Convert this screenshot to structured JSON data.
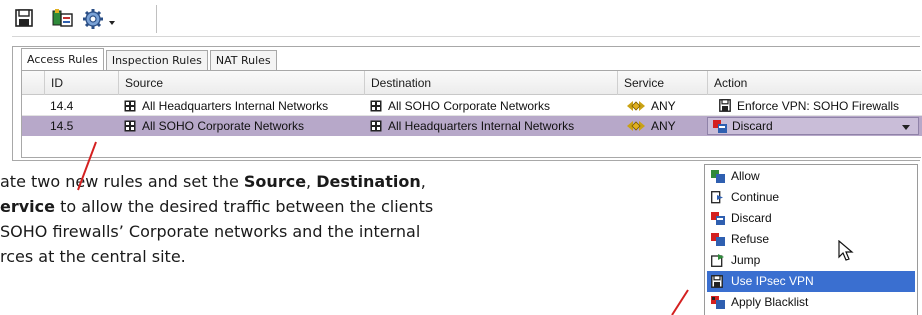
{
  "toolbar": {
    "icons": [
      "save-icon",
      "copy-policy-icon",
      "settings-gear-icon",
      "chevron-down-icon"
    ]
  },
  "tabs": [
    {
      "label": "Access Rules",
      "active": true
    },
    {
      "label": "Inspection Rules",
      "active": false
    },
    {
      "label": "NAT Rules",
      "active": false
    }
  ],
  "table": {
    "headers": [
      "ID",
      "Source",
      "Destination",
      "Service",
      "Action"
    ],
    "rows": [
      {
        "id": "14.4",
        "source": "All Headquarters Internal Networks",
        "destination": "All SOHO Corporate Networks",
        "service": "ANY",
        "action": "Enforce VPN: SOHO Firewalls",
        "selected": false
      },
      {
        "id": "14.5",
        "source": "All SOHO Corporate Networks",
        "destination": "All Headquarters Internal Networks",
        "service": "ANY",
        "action": "Discard",
        "selected": true
      }
    ]
  },
  "action_dropdown": {
    "selected": "Discard",
    "options": [
      {
        "label": "Allow",
        "icon": "allow-icon"
      },
      {
        "label": "Continue",
        "icon": "continue-icon"
      },
      {
        "label": "Discard",
        "icon": "discard-icon"
      },
      {
        "label": "Refuse",
        "icon": "refuse-icon"
      },
      {
        "label": "Jump",
        "icon": "jump-icon"
      },
      {
        "label": "Use IPsec VPN",
        "icon": "vpn-icon",
        "highlighted": true
      },
      {
        "label": "Apply Blacklist",
        "icon": "blacklist-icon"
      }
    ]
  },
  "instructions": {
    "line1_a": "ate two new rules and set the ",
    "line1_b": "Source",
    "line1_c": ", ",
    "line1_d": "Destination",
    "line1_e": ",",
    "line2_a": "ervice",
    "line2_b": " to allow the desired traffic between the clients",
    "line3": "SOHO firewalls’ Corporate networks and the internal",
    "line4": "rces at the central site."
  },
  "colors": {
    "selected_row": "#b7a8c9",
    "highlight": "#3a6fd0",
    "callout": "#d42020"
  }
}
